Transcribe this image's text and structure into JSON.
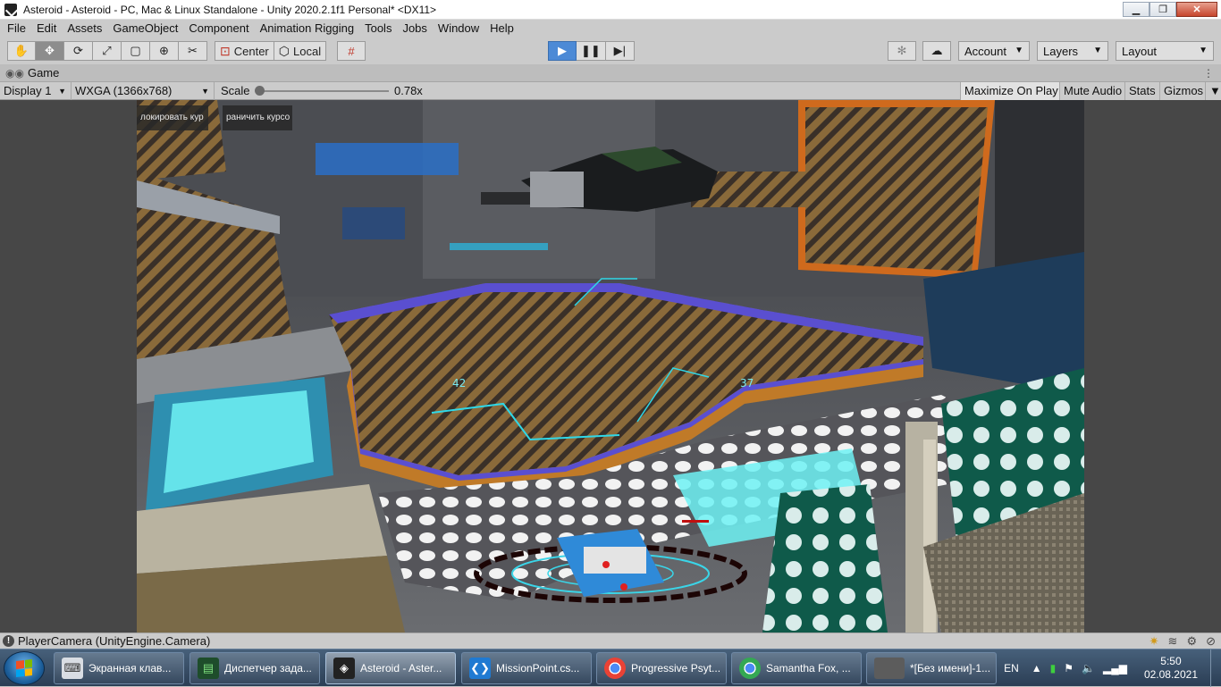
{
  "window": {
    "title": "Asteroid - Asteroid - PC, Mac & Linux Standalone - Unity 2020.2.1f1 Personal* <DX11>",
    "minimize": "▁",
    "restore": "❐",
    "close": "✕"
  },
  "menu": [
    "File",
    "Edit",
    "Assets",
    "GameObject",
    "Component",
    "Animation Rigging",
    "Tools",
    "Jobs",
    "Window",
    "Help"
  ],
  "toolbar": {
    "tools": [
      "hand-tool",
      "move-tool",
      "rotate-tool",
      "scale-tool",
      "rect-tool",
      "transform-tool",
      "custom-tool"
    ],
    "pivot_label": "Center",
    "space_label": "Local",
    "account_label": "Account",
    "layers_label": "Layers",
    "layout_label": "Layout"
  },
  "game_tab": {
    "label": "Game"
  },
  "game_controls": {
    "display": "Display 1",
    "resolution": "WXGA (1366x768)",
    "scale_label": "Scale",
    "scale_value": "0.78x",
    "scale_fraction": 0.0,
    "toggles": [
      "Maximize On Play",
      "Mute Audio",
      "Stats",
      "Gizmos"
    ]
  },
  "hud": {
    "button_left": "локировать кур",
    "button_right": "раничить курсо",
    "reading_left": "42",
    "reading_right": "37"
  },
  "status": {
    "message": "PlayerCamera (UnityEngine.Camera)"
  },
  "taskbar": {
    "tasks": [
      {
        "label": "Экранная клав...",
        "icon": "keyboard-icon"
      },
      {
        "label": "Диспетчер зада...",
        "icon": "task-manager-icon"
      },
      {
        "label": "Asteroid - Aster...",
        "icon": "unity-icon"
      },
      {
        "label": "MissionPoint.cs...",
        "icon": "vscode-icon"
      },
      {
        "label": "Progressive Psyt...",
        "icon": "chrome-icon"
      },
      {
        "label": "Samantha Fox, ...",
        "icon": "chrome-icon"
      },
      {
        "label": "*[Без имени]-1...",
        "icon": "paint-icon"
      }
    ],
    "language": "EN",
    "time": "5:50",
    "date": "02.08.2021"
  },
  "colors": {
    "play_accent": "#4c8ad6",
    "hud_cyan": "#77e9f0",
    "platform_purple": "#5a4fd0"
  }
}
